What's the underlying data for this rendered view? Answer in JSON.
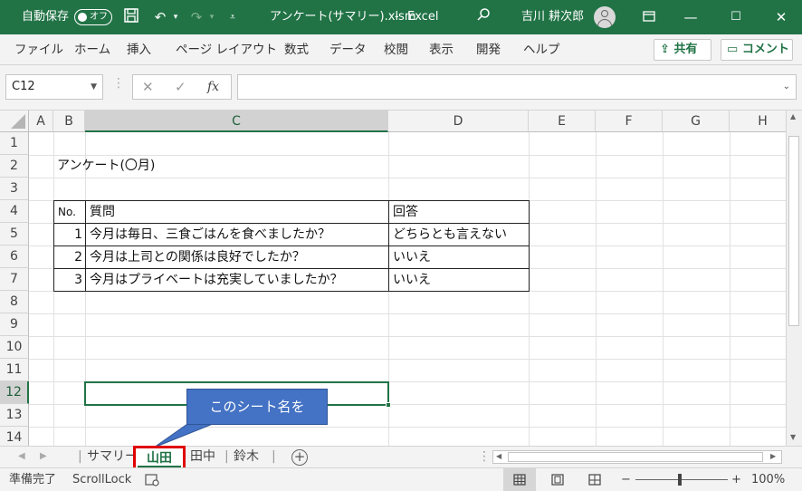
{
  "titlebar": {
    "autosave_label": "自動保存",
    "autosave_state": "オフ",
    "filename": "アンケート(サマリー).xlsm",
    "separator": "-",
    "app": "Excel",
    "user": "吉川 耕次郎"
  },
  "menu": {
    "items": [
      "ファイル",
      "ホーム",
      "挿入",
      "ページ レイアウト",
      "数式",
      "データ",
      "校閲",
      "表示",
      "開発",
      "ヘルプ"
    ],
    "share_label": "共有",
    "comment_label": "コメント"
  },
  "formula": {
    "name_box": "C12",
    "cancel_glyph": "✕",
    "enter_glyph": "✓",
    "fx_label": "fx",
    "content": ""
  },
  "sheet": {
    "columns": [
      "A",
      "B",
      "C",
      "D",
      "E",
      "F",
      "G",
      "H"
    ],
    "rows": [
      "1",
      "2",
      "3",
      "4",
      "5",
      "6",
      "7",
      "8",
      "9",
      "10",
      "11",
      "12",
      "13",
      "14"
    ],
    "title": "アンケート(〇月)",
    "table": {
      "headers": [
        "No.",
        "質問",
        "回答"
      ],
      "rows": [
        {
          "no": "1",
          "question": "今月は毎日、三食ごはんを食べましたか？",
          "answer": "どちらとも言えない"
        },
        {
          "no": "2",
          "question": "今月は上司との関係は良好でしたか？",
          "answer": "いいえ"
        },
        {
          "no": "3",
          "question": "今月はプライベートは充実していましたか？",
          "answer": "いいえ"
        }
      ]
    },
    "selected_cell": "C12"
  },
  "callout": {
    "text": "このシート名を"
  },
  "tabs": {
    "items": [
      "サマリー",
      "山田",
      "田中",
      "鈴木"
    ],
    "active": "山田"
  },
  "status": {
    "ready": "準備完了",
    "scroll_lock": "ScrollLock",
    "zoom": "100%"
  },
  "colors": {
    "excel_green": "#217346",
    "highlight_red": "#e00000",
    "callout_blue": "#4472c4"
  }
}
